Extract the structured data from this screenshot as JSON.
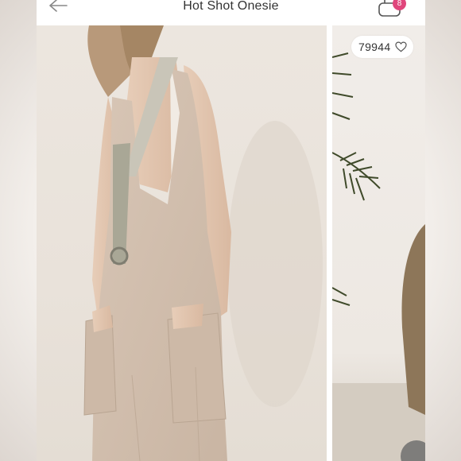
{
  "header": {
    "title": "Hot Shot Onesie",
    "cart_count": "8"
  },
  "gallery": {
    "like_count": "79944"
  },
  "colors": {
    "accent_badge": "#e0467c",
    "title_text": "#333333"
  },
  "icons": {
    "back": "back-arrow-icon",
    "cart": "shopping-bag-icon",
    "like": "heart-icon"
  }
}
